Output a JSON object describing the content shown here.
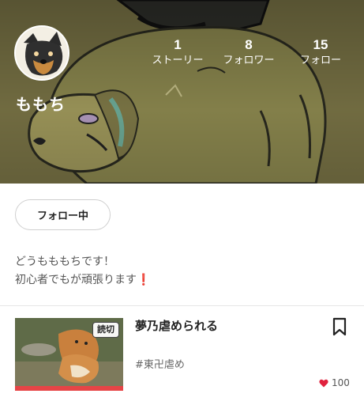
{
  "profile": {
    "username": "ももち",
    "stats": [
      {
        "value": "1",
        "label": "ストーリー"
      },
      {
        "value": "8",
        "label": "フォロワー"
      },
      {
        "value": "15",
        "label": "フォロー"
      }
    ],
    "follow_button_label": "フォロー中",
    "bio_line1": "どうもももちです！",
    "bio_line2": "初心者でもが頑張ります",
    "bio_emoji": "❗"
  },
  "stories": [
    {
      "badge": "読切",
      "title": "夢乃虐められる",
      "tag": "#東卍虐め",
      "likes": "100"
    }
  ],
  "colors": {
    "accent_red": "#e64446",
    "heart": "#e0213d"
  },
  "icons": [
    "bookmark-icon",
    "heart-icon"
  ]
}
